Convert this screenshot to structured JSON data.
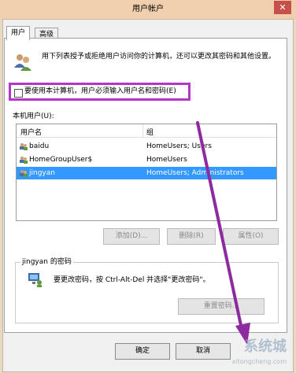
{
  "window": {
    "title": "用户帐户",
    "close_glyph": "✕"
  },
  "tabs": [
    {
      "label": "用户"
    },
    {
      "label": "高级"
    }
  ],
  "intro_text": "用下列表授予或拒绝用户访问你的计算机，还可以更改其密码和其他设置。",
  "require_login_checkbox": {
    "label": "要使用本计算机，用户必须输入用户名和密码(E)",
    "checked": false
  },
  "users_section_label": "本机用户(U):",
  "table": {
    "columns": [
      "用户名",
      "组"
    ],
    "rows": [
      {
        "name": "baidu",
        "group": "HomeUsers; Users"
      },
      {
        "name": "HomeGroupUser$",
        "group": "HomeUsers"
      },
      {
        "name": "jingyan",
        "group": "HomeUsers; Administrators"
      }
    ],
    "selected_row": "jingyan"
  },
  "list_buttons": {
    "add": "添加(D)...",
    "remove": "删除(R)",
    "properties": "属性(O)"
  },
  "password_group": {
    "legend": "jingyan 的密码",
    "text": "要更改密码，按 Ctrl-Alt-Del 并选择\"更改密码\"。",
    "reset_button": "重置密码..."
  },
  "footer": {
    "ok": "确定",
    "cancel": "取消"
  },
  "watermark": {
    "text": "系统城",
    "url": "xitongcheng.com"
  },
  "colors": {
    "highlight_box": "#b237c4",
    "arrow": "#8e2aa0",
    "selection": "#3399ff",
    "titlebar": "#f0cfae"
  }
}
